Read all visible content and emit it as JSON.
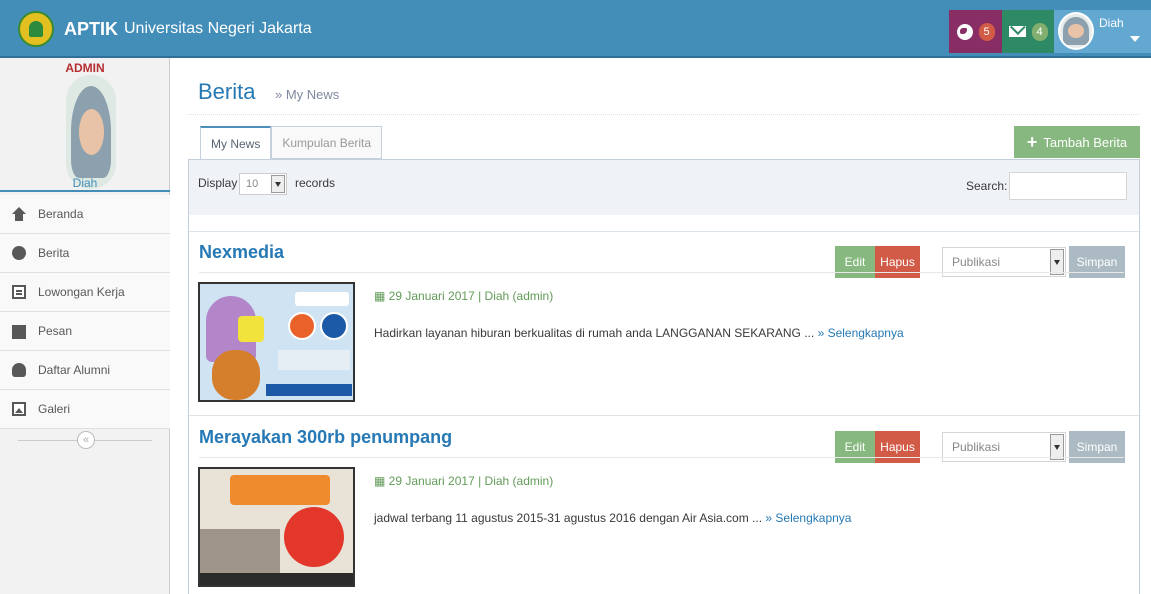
{
  "navbar": {
    "brand_bold": "APTIK",
    "brand_rest": "Universitas Negeri Jakarta",
    "tasks_count": "5",
    "messages_count": "4",
    "user_name": "Diah",
    "colors": {
      "bar": "#438eb9",
      "tasks": "#892e65",
      "messages": "#2e8965",
      "user": "#62a8d1"
    }
  },
  "sidebar": {
    "role": "ADMIN",
    "name": "Diah",
    "items": [
      {
        "label": "Beranda",
        "icon": "home-icon"
      },
      {
        "label": "Berita",
        "icon": "globe-icon"
      },
      {
        "label": "Lowongan Kerja",
        "icon": "list-icon"
      },
      {
        "label": "Pesan",
        "icon": "envelope-icon"
      },
      {
        "label": "Daftar Alumni",
        "icon": "users-icon"
      },
      {
        "label": "Galeri",
        "icon": "picture-icon"
      }
    ],
    "collapse_symbol": "«"
  },
  "page": {
    "title": "Berita",
    "subtitle": "» My News"
  },
  "tabs": [
    {
      "label": "My News",
      "active": true
    },
    {
      "label": "Kumpulan Berita",
      "active": false
    }
  ],
  "add_button": {
    "plus": "+",
    "label": "Tambah Berita"
  },
  "table_controls": {
    "display_label": "Display",
    "page_length": "10",
    "records_label": "records",
    "search_label": "Search:",
    "search_value": ""
  },
  "news": [
    {
      "title": "Nexmedia",
      "edit_label": "Edit",
      "delete_label": "Hapus",
      "status": "Publikasi",
      "save_label": "Simpan",
      "meta": "29 Januari 2017 | Diah (admin)",
      "description": "Hadirkan layanan hiburan berkualitas di rumah anda LANGGANAN SEKARANG ... ",
      "more": "» Selengkapnya"
    },
    {
      "title": "Merayakan 300rb penumpang",
      "edit_label": "Edit",
      "delete_label": "Hapus",
      "status": "Publikasi",
      "save_label": "Simpan",
      "meta": "29 Januari 2017 | Diah (admin)",
      "description": "jadwal terbang 11 agustus 2015-31 agustus 2016 dengan Air Asia.com ... ",
      "more": "» Selengkapnya"
    }
  ]
}
